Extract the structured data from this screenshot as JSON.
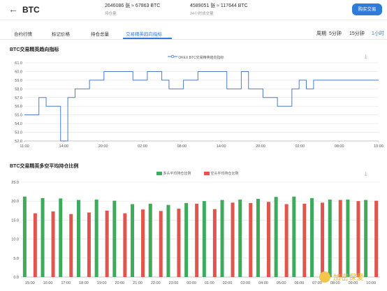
{
  "header": {
    "back_icon": "arrow-left-icon",
    "symbol": "BTC",
    "stat1": "2646086 张 ≈ 67863 BTC",
    "stat1_sub": "持仓量",
    "stat2": "4589051 张 ≈ 117644 BTC",
    "stat2_sub": "24小时成交量",
    "buy_label": "购买交易"
  },
  "tabs": [
    "合约行情",
    "标记价格",
    "持仓总量",
    "交易精英趋向指标"
  ],
  "periods": [
    "周期",
    "5分钟",
    "15分钟",
    "1小时"
  ],
  "chart1_title": "BTC交易精英趋向指标",
  "chart2_title": "BTC交易精英多空平均持仓比例",
  "watermark": "加密保爱",
  "chart_data": [
    {
      "type": "line",
      "legend": [
        "OKEX BTC交易精英趋向指标"
      ],
      "ylim": [
        55,
        61
      ],
      "yticks": [
        "61.0",
        "60.0",
        "59.0",
        "58.0",
        "57.0",
        "56.0",
        "55.0",
        "54.0",
        "53.0",
        "52.0"
      ],
      "yvals": [
        61,
        60,
        59,
        58,
        57,
        56,
        55,
        54,
        53,
        52
      ],
      "xticks": [
        "11:00",
        "14:00",
        "20:00",
        "02:00",
        "08:00",
        "14:00",
        "20:00",
        "02:00",
        "08:00",
        "10:00"
      ],
      "series": [
        {
          "color": "#4a7bd1",
          "values": [
            55,
            55,
            57,
            56,
            56,
            52,
            57,
            58,
            58,
            59,
            59,
            60,
            60,
            60,
            60,
            59,
            59,
            60,
            60,
            59,
            58,
            58,
            59,
            59,
            60,
            60,
            60,
            60,
            58,
            58,
            60,
            58,
            58,
            57,
            57,
            56,
            56,
            58,
            59,
            58,
            59,
            59,
            59,
            59,
            59,
            59,
            59,
            59,
            59,
            59
          ]
        }
      ]
    },
    {
      "type": "bar",
      "legend": [
        "多头平均持仓比例",
        "空头平均持仓比例"
      ],
      "ylim": [
        0,
        25
      ],
      "yticks": [
        "25.0",
        "20.0",
        "15.0",
        "10.0",
        "5.0",
        "0.0"
      ],
      "yvals": [
        25,
        20,
        15,
        10,
        5,
        0
      ],
      "categories": [
        "15:00",
        "16:00",
        "17:00",
        "18:00",
        "19:00",
        "20:00",
        "21:00",
        "22:00",
        "23:00",
        "00:00",
        "01:00",
        "02:00",
        "03:00",
        "04:00",
        "05:00",
        "06:00",
        "07:00",
        "08:00",
        "09:00",
        "10:00"
      ],
      "series": [
        {
          "name": "多头平均持仓比例",
          "color": "#3daa5c",
          "values": [
            21.2,
            20.8,
            20.7,
            20.3,
            20.4,
            20.1,
            19.2,
            19.3,
            19.0,
            19.5,
            20.0,
            20.3,
            20.4,
            20.6,
            21.1,
            21.2,
            20.8,
            20.4,
            20.4,
            20.3
          ]
        },
        {
          "name": "空头平均持仓比例",
          "color": "#e0554e",
          "values": [
            16.8,
            17.3,
            16.6,
            17.0,
            17.5,
            16.8,
            17.8,
            17.4,
            18.0,
            19.3,
            17.9,
            19.6,
            19.5,
            19.8,
            19.2,
            19.3,
            19.6,
            20.3,
            20.0,
            20.1
          ]
        }
      ]
    }
  ]
}
